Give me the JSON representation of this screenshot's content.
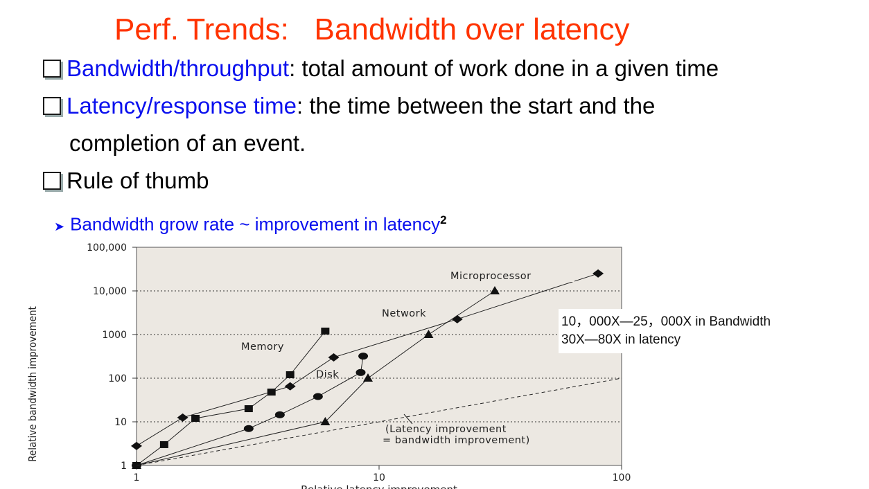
{
  "slide": {
    "title": "Perf. Trends:   Bandwidth over latency",
    "bullets": [
      {
        "term": "Bandwidth/throughput",
        "text": ": total amount of work done in a given time"
      },
      {
        "term": "Latency/response time",
        "text": ": the time between the start and the"
      },
      {
        "term": "",
        "text": "Rule of thumb"
      }
    ],
    "bullet2_continuation": "completion of an event.",
    "sub_bullet": {
      "text": "Bandwidth grow rate ~ improvement in latency",
      "superscript": "2"
    },
    "callout": {
      "line1": "10，000X—25，000X in Bandwidth",
      "line2": "30X—80X in latency"
    }
  },
  "colors": {
    "title": "#ff3300",
    "term": "#0a10ee",
    "plot_bg": "#ece8e2"
  },
  "icons": {
    "bullet": "hollow-square-bullet",
    "sub_bullet": "right-arrowhead"
  },
  "chart_data": {
    "type": "line",
    "xscale": "log",
    "yscale": "log",
    "xlim": [
      1,
      100
    ],
    "ylim": [
      1,
      100000
    ],
    "xlabel": "Relative latency improvement",
    "ylabel": "Relative bandwidth improvement",
    "xticks": [
      "1",
      "10",
      "100"
    ],
    "yticks": [
      "1",
      "10",
      "100",
      "1000",
      "10,000",
      "100,000"
    ],
    "grid": "horizontal dotted",
    "series": [
      {
        "name": "Microprocessor",
        "marker": "diamond",
        "points": [
          [
            1,
            2.8
          ],
          [
            1.55,
            12.5
          ],
          [
            4.3,
            65
          ],
          [
            6.5,
            300
          ],
          [
            21,
            2250
          ],
          [
            80,
            25000
          ]
        ]
      },
      {
        "name": "Memory",
        "marker": "square",
        "points": [
          [
            1,
            1
          ],
          [
            1.3,
            3
          ],
          [
            1.75,
            12
          ],
          [
            2.9,
            20
          ],
          [
            3.6,
            48
          ],
          [
            4.3,
            120
          ],
          [
            6,
            1200
          ]
        ]
      },
      {
        "name": "Network",
        "marker": "triangle",
        "points": [
          [
            1,
            1
          ],
          [
            6,
            10
          ],
          [
            9,
            100
          ],
          [
            16,
            1000
          ],
          [
            30,
            10000
          ]
        ]
      },
      {
        "name": "Disk",
        "marker": "circle",
        "points": [
          [
            1,
            1
          ],
          [
            2.9,
            7
          ],
          [
            3.9,
            14.5
          ],
          [
            5.6,
            38
          ],
          [
            8.4,
            135
          ],
          [
            8.6,
            320
          ]
        ]
      },
      {
        "name": "",
        "marker": "none",
        "style": "dashed",
        "points": [
          [
            1,
            1
          ],
          [
            100,
            100
          ]
        ]
      }
    ],
    "annotations": [
      {
        "text": "Microprocessor"
      },
      {
        "text": "Network"
      },
      {
        "text": "Memory"
      },
      {
        "text": "Disk"
      },
      {
        "text": "(Latency improvement"
      },
      {
        "text": "= bandwidth improvement)"
      }
    ]
  }
}
